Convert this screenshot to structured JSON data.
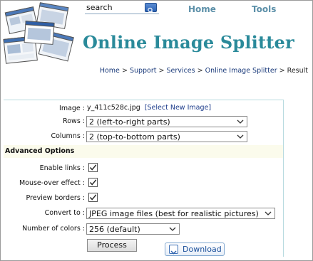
{
  "header": {
    "search": {
      "value": "search"
    },
    "nav": {
      "home": "Home",
      "tools": "Tools"
    },
    "site_title": "Online Image Splitter",
    "breadcrumb": {
      "home": "Home",
      "support": "Support",
      "services": "Services",
      "splitter": "Online Image Splitter",
      "current": "Result",
      "separator": ">"
    }
  },
  "form": {
    "image": {
      "label": "Image :",
      "filename": "y_411c528c.jpg",
      "select_link": "[Select New Image]"
    },
    "rows": {
      "label": "Rows :",
      "selected": "2 (left-to-right parts)"
    },
    "columns": {
      "label": "Columns :",
      "selected": "2 (top-to-bottom parts)"
    },
    "advanced_title": "Advanced Options",
    "enable_links": {
      "label": "Enable links :",
      "checked": true
    },
    "mouse_over": {
      "label": "Mouse-over effect :",
      "checked": true
    },
    "preview_borders": {
      "label": "Preview borders :",
      "checked": true
    },
    "convert_to": {
      "label": "Convert to :",
      "selected": "JPEG image files (best for realistic pictures)"
    },
    "num_colors": {
      "label": "Number of colors :",
      "selected": "256 (default)"
    },
    "process_button": "Process",
    "download_button": "Download"
  },
  "colors": {
    "title": "#2a8a9a",
    "nav": "#5b8fa8",
    "link": "#1a3a8a",
    "panel_border": "#b8dbe0",
    "advanced_bg": "#fbfbec"
  }
}
